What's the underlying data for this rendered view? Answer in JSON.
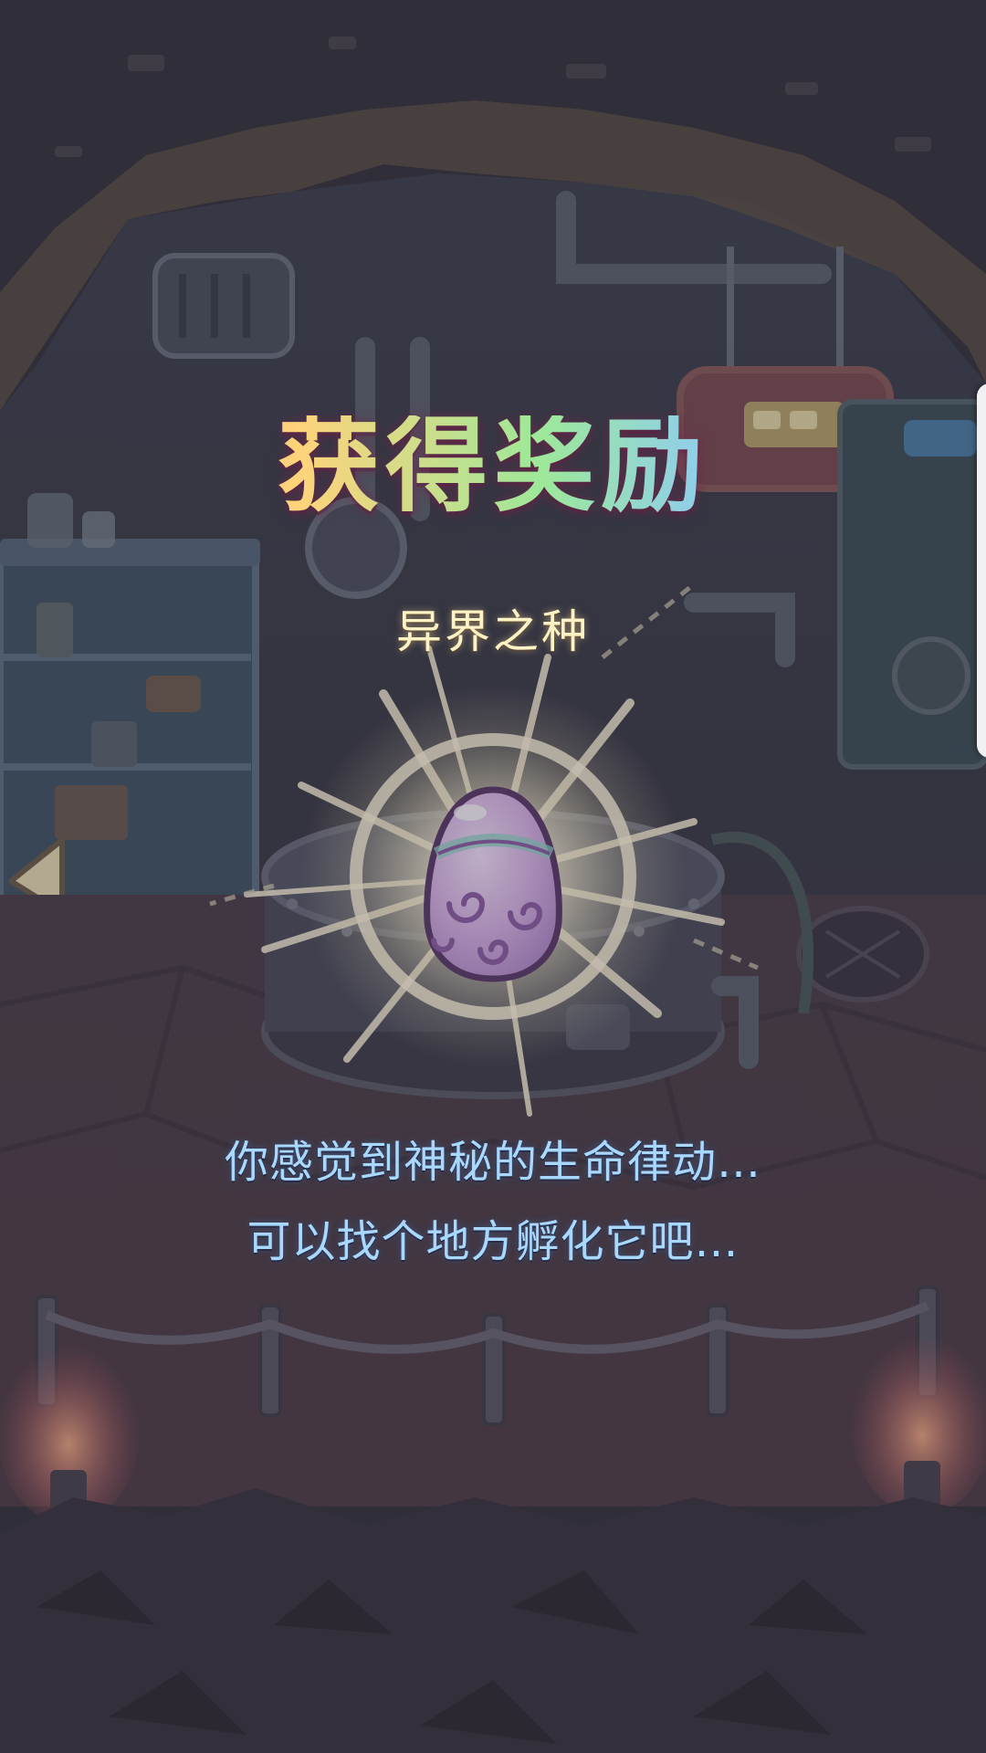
{
  "reward": {
    "title": "获得奖励",
    "item_name": "异界之种",
    "description_line1": "你感觉到神秘的生命律动…",
    "description_line2": "可以找个地方孵化它吧…"
  },
  "icons": {
    "egg": "alien-egg-icon",
    "back": "back-arrow-icon",
    "bed_sign": "bed-sign-icon"
  },
  "colors": {
    "background": "#2f2d36",
    "title_gradient": [
      "#ff8fb8",
      "#ffd37a",
      "#9de89a",
      "#8cc8ff",
      "#d7a0ff"
    ],
    "item_name": "#fff2c4",
    "description": "#a9d8ff",
    "egg_shell": "#dcb6ea",
    "egg_swirl": "#8d5ea6"
  }
}
